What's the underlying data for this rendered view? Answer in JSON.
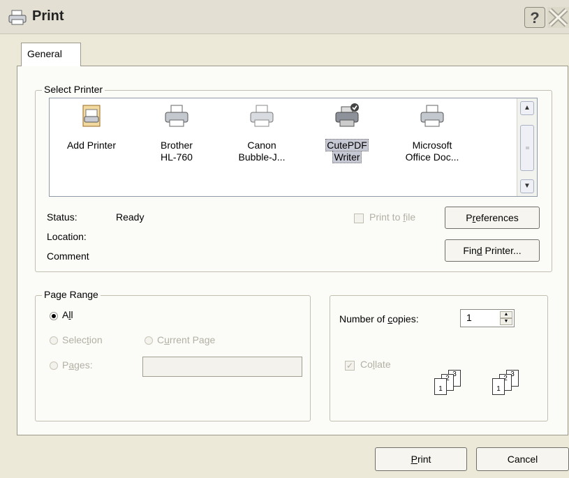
{
  "window": {
    "title": "Print",
    "help_glyph": "?"
  },
  "tabs": [
    {
      "label": "General",
      "selected": true
    }
  ],
  "select_printer": {
    "group_title": "Select Printer",
    "printers": [
      {
        "line1": "Add Printer",
        "line2": "",
        "icon": "add-printer-icon",
        "selected": false
      },
      {
        "line1": "Brother",
        "line2": "HL-760",
        "icon": "printer-icon",
        "selected": false
      },
      {
        "line1": "Canon",
        "line2": "Bubble-J...",
        "icon": "printer-icon",
        "selected": false
      },
      {
        "line1": "CutePDF",
        "line2": "Writer",
        "icon": "default-printer-icon",
        "selected": true
      },
      {
        "line1": "Microsoft",
        "line2": "Office Doc...",
        "icon": "printer-icon",
        "selected": false
      }
    ],
    "status_label": "Status:",
    "status_value": "Ready",
    "location_label": "Location:",
    "comment_label": "Comment",
    "print_to_file": {
      "pre": "Print to ",
      "u": "f",
      "post": "ile",
      "checked": false
    },
    "preferences": {
      "pre": "P",
      "u": "r",
      "post": "eferences"
    },
    "find_printer": {
      "pre": "Fin",
      "u": "d",
      "post": " Printer..."
    }
  },
  "page_range": {
    "group_title": "Page Range",
    "all": {
      "pre": "A",
      "u": "l",
      "post": "l",
      "checked": true
    },
    "selection": {
      "pre": "Selec",
      "u": "t",
      "post": "ion",
      "checked": false
    },
    "current_page": {
      "pre": "C",
      "u": "u",
      "post": "rrent Page",
      "checked": false
    },
    "pages": {
      "pre": "P",
      "u": "a",
      "post": "ges:",
      "checked": false,
      "value": ""
    }
  },
  "copies": {
    "label_pre": "Number of ",
    "label_u": "c",
    "label_post": "opies:",
    "value": "1",
    "collate": {
      "pre": "Co",
      "u": "l",
      "post": "late",
      "checked": true
    },
    "collate_pages": [
      "1",
      "2",
      "3"
    ]
  },
  "footer": {
    "print": {
      "u": "P",
      "post": "rint"
    },
    "cancel": "Cancel"
  },
  "colors": {
    "face": "#ece9d8",
    "panel": "#fbfbf7",
    "list_bg": "#ffffff",
    "disabled_text": "#b3b0a4"
  }
}
